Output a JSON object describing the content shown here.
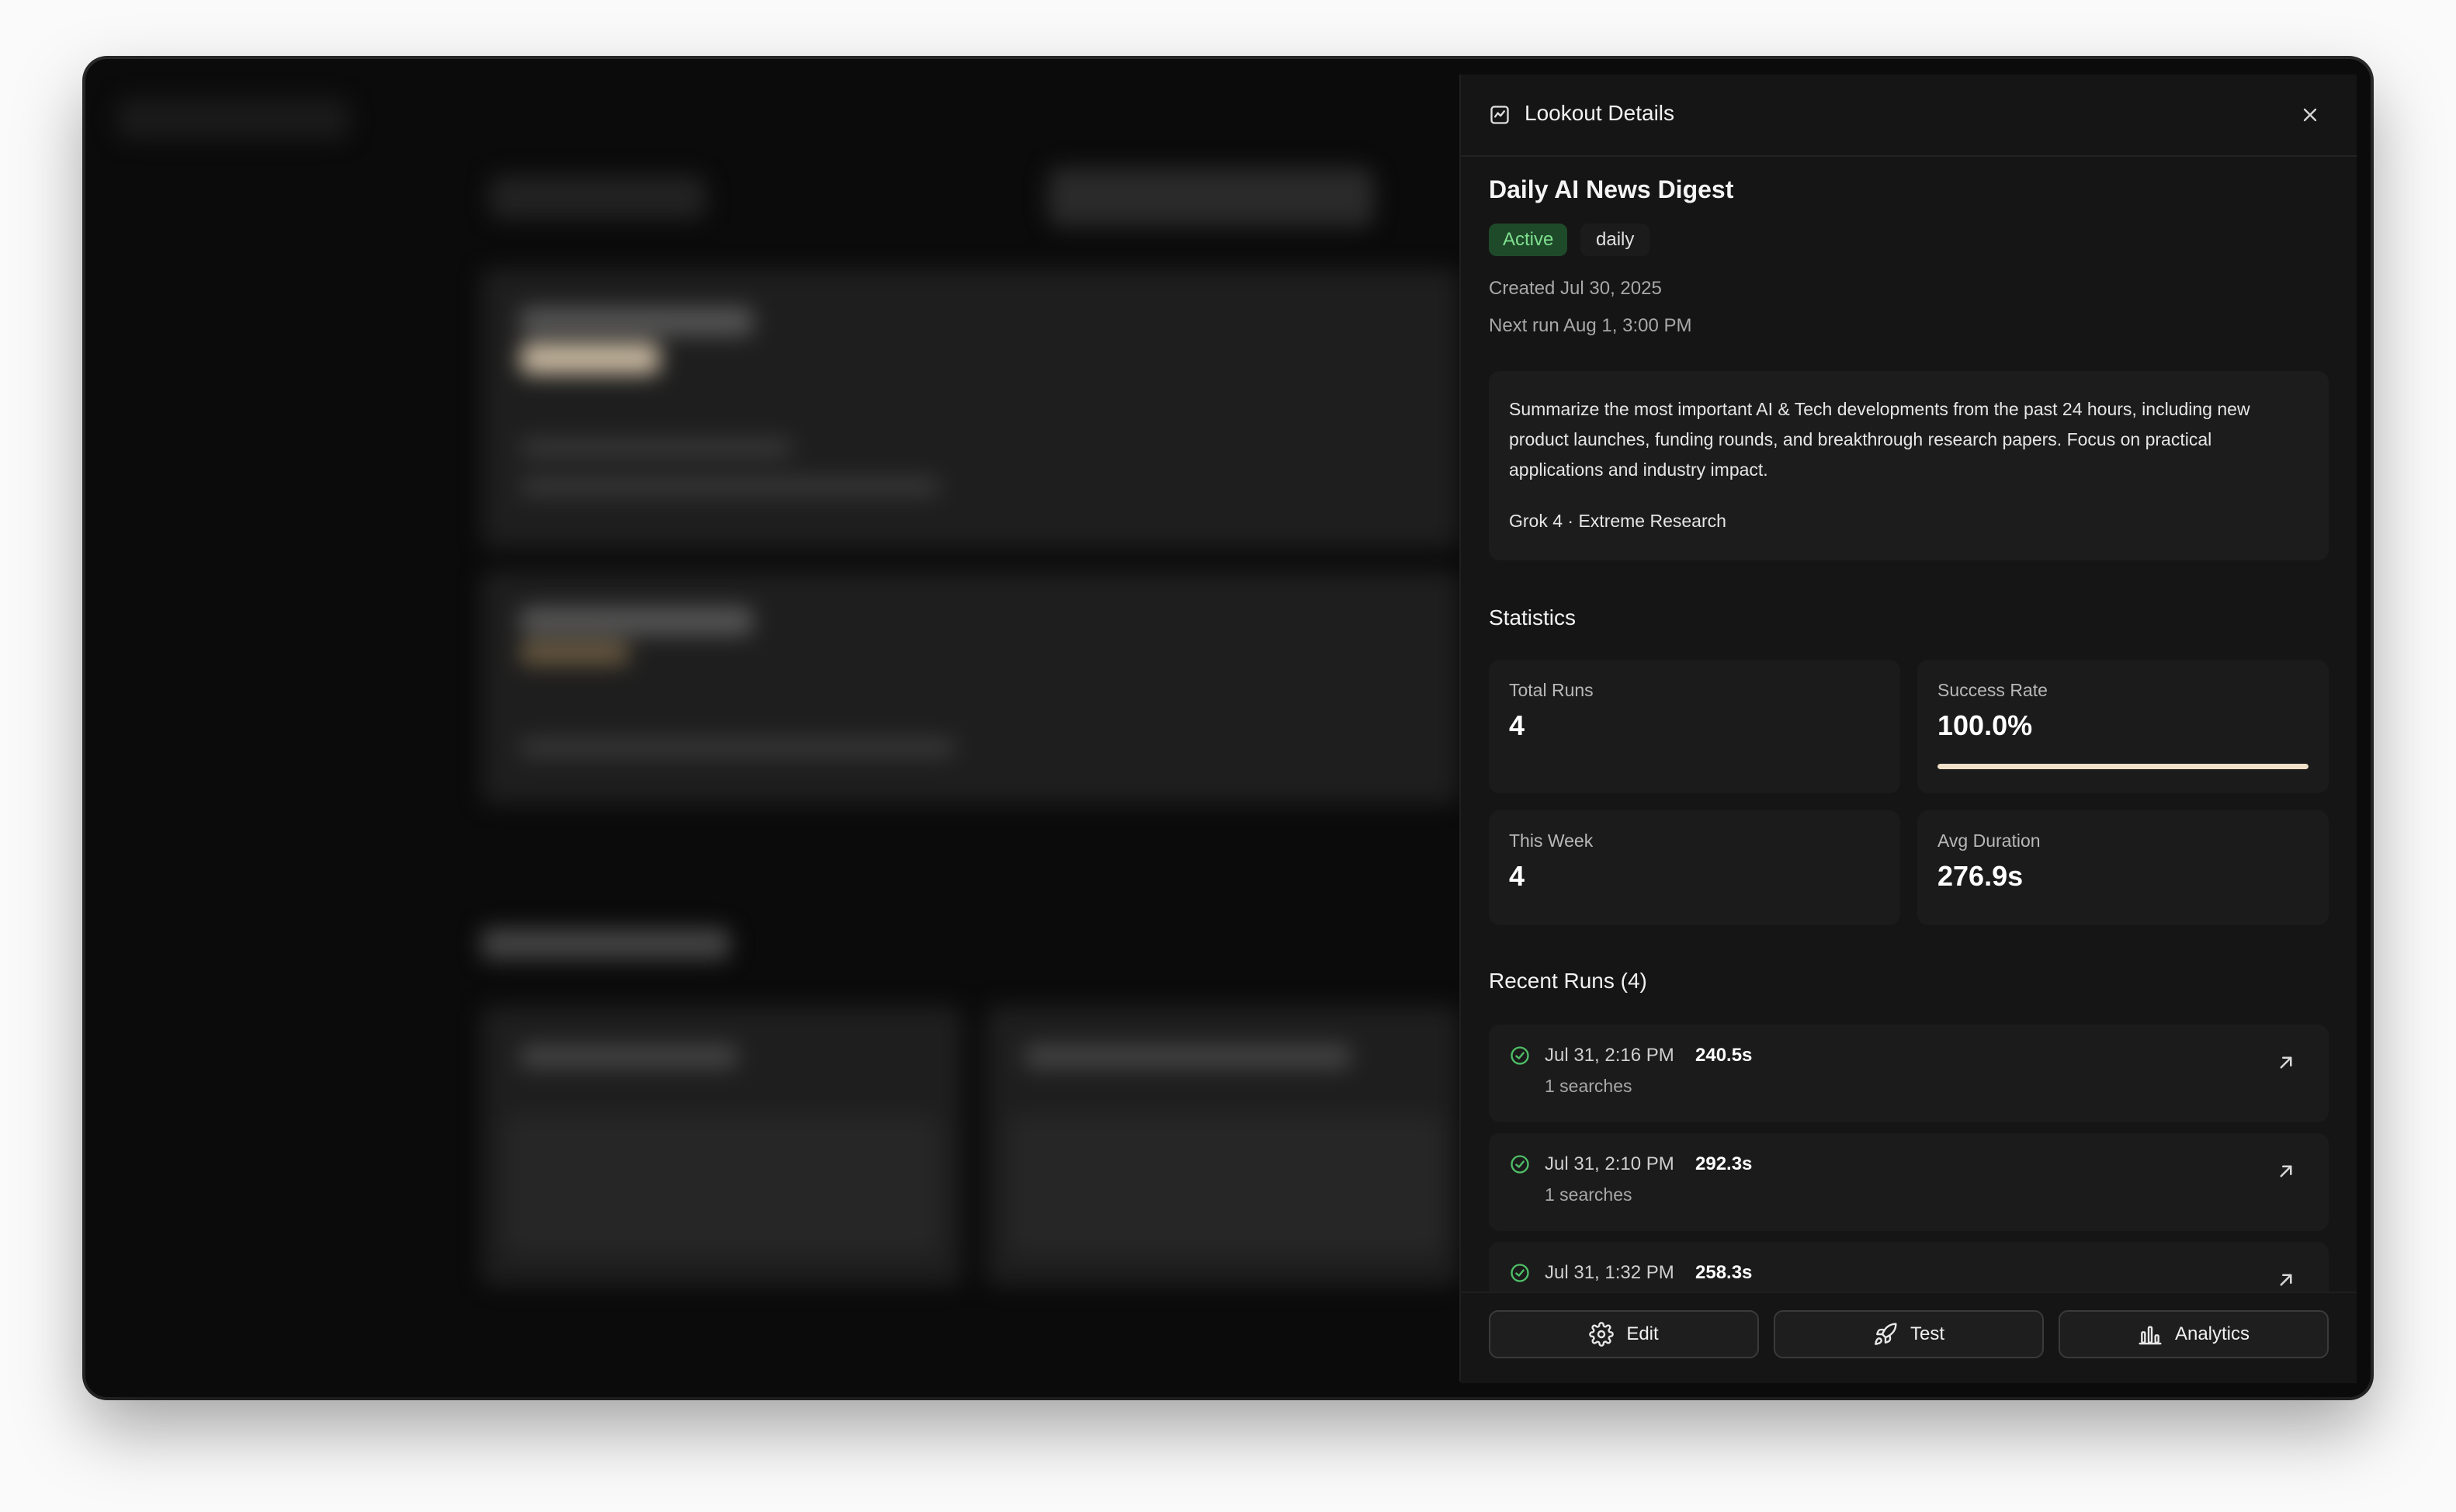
{
  "panel": {
    "title": "Lookout Details",
    "header_icon": "activity-chart-icon",
    "close_icon": "close-icon"
  },
  "lookout": {
    "title": "Daily AI News Digest",
    "status": "Active",
    "frequency": "daily",
    "created": "Created Jul 30, 2025",
    "next_run": "Next run Aug 1, 3:00 PM",
    "prompt": "Summarize the most important AI & Tech developments from the past 24 hours, including new product launches, funding rounds, and breakthrough research papers. Focus on practical applications and industry impact.",
    "model_mode": "Grok 4 · Extreme Research"
  },
  "statistics": {
    "title": "Statistics",
    "total_runs": {
      "label": "Total Runs",
      "value": "4"
    },
    "success_rate": {
      "label": "Success Rate",
      "value": "100.0%",
      "fraction": 1.0
    },
    "this_week": {
      "label": "This Week",
      "value": "4"
    },
    "avg_duration": {
      "label": "Avg Duration",
      "value": "276.9s"
    }
  },
  "recent_runs": {
    "title": "Recent Runs (4)",
    "items": [
      {
        "date": "Jul 31, 2:16 PM",
        "duration": "240.5s",
        "searches": "1 searches",
        "status": "success"
      },
      {
        "date": "Jul 31, 2:10 PM",
        "duration": "292.3s",
        "searches": "1 searches",
        "status": "success"
      },
      {
        "date": "Jul 31, 1:32 PM",
        "duration": "258.3s",
        "searches": "",
        "status": "success"
      }
    ]
  },
  "footer": {
    "edit_label": "Edit",
    "test_label": "Test",
    "analytics_label": "Analytics"
  },
  "colors": {
    "active_badge_bg": "#1f4a2a",
    "active_badge_text": "#7ee08f",
    "success_check": "#4fbf67",
    "progress_fill": "#f0e0c8"
  }
}
